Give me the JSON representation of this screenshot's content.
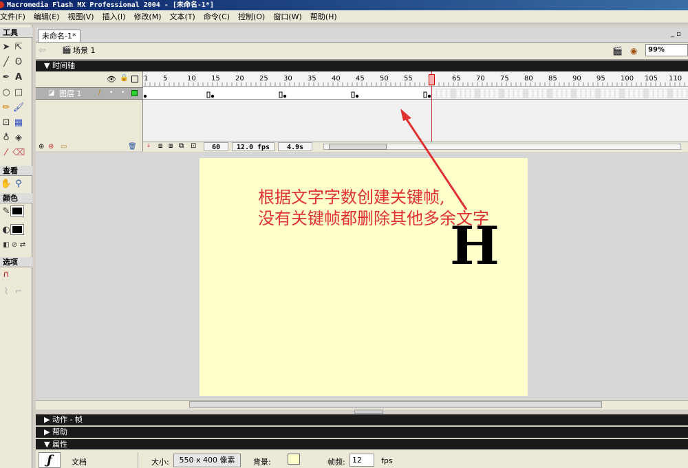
{
  "window": {
    "title": "Macromedia Flash MX Professional 2004 - [未命名-1*]"
  },
  "menu": [
    "文件(F)",
    "编辑(E)",
    "视图(V)",
    "插入(I)",
    "修改(M)",
    "文本(T)",
    "命令(C)",
    "控制(O)",
    "窗口(W)",
    "帮助(H)"
  ],
  "tools": {
    "header": "工具",
    "view_header": "查看",
    "color_header": "颜色",
    "options_header": "选项"
  },
  "document": {
    "tab": "未命名-1*",
    "scene": "场景 1",
    "zoom": "99%"
  },
  "timeline": {
    "header": "时间轴",
    "layer_name": "图层 1",
    "ruler_labels": [
      "1",
      "5",
      "10",
      "15",
      "20",
      "25",
      "30",
      "35",
      "40",
      "45",
      "50",
      "55",
      "60",
      "65",
      "70",
      "75",
      "80",
      "85",
      "90",
      "95",
      "100",
      "105",
      "110"
    ],
    "current_frame": "60",
    "frame_rate": "12.0 fps",
    "elapsed": "4.9s",
    "keyframes": [
      1,
      15,
      30,
      45,
      60
    ]
  },
  "stage": {
    "annotation_line1": "根据文字字数创建关键帧,",
    "annotation_line2": "没有关键帧都删除其他多余文字",
    "letter": "H"
  },
  "panels": {
    "actions": "动作 - 帧",
    "help": "帮助",
    "properties": "属性"
  },
  "properties": {
    "type_label": "文档",
    "size_label": "大小:",
    "size_value": "550 x 400 像素",
    "bg_label": "背景:",
    "fps_label": "帧频:",
    "fps_value": "12",
    "fps_unit": "fps"
  },
  "colors": {
    "annotation": "#e03030",
    "stage": "#ffffcc",
    "playhead": "#cc3333"
  }
}
